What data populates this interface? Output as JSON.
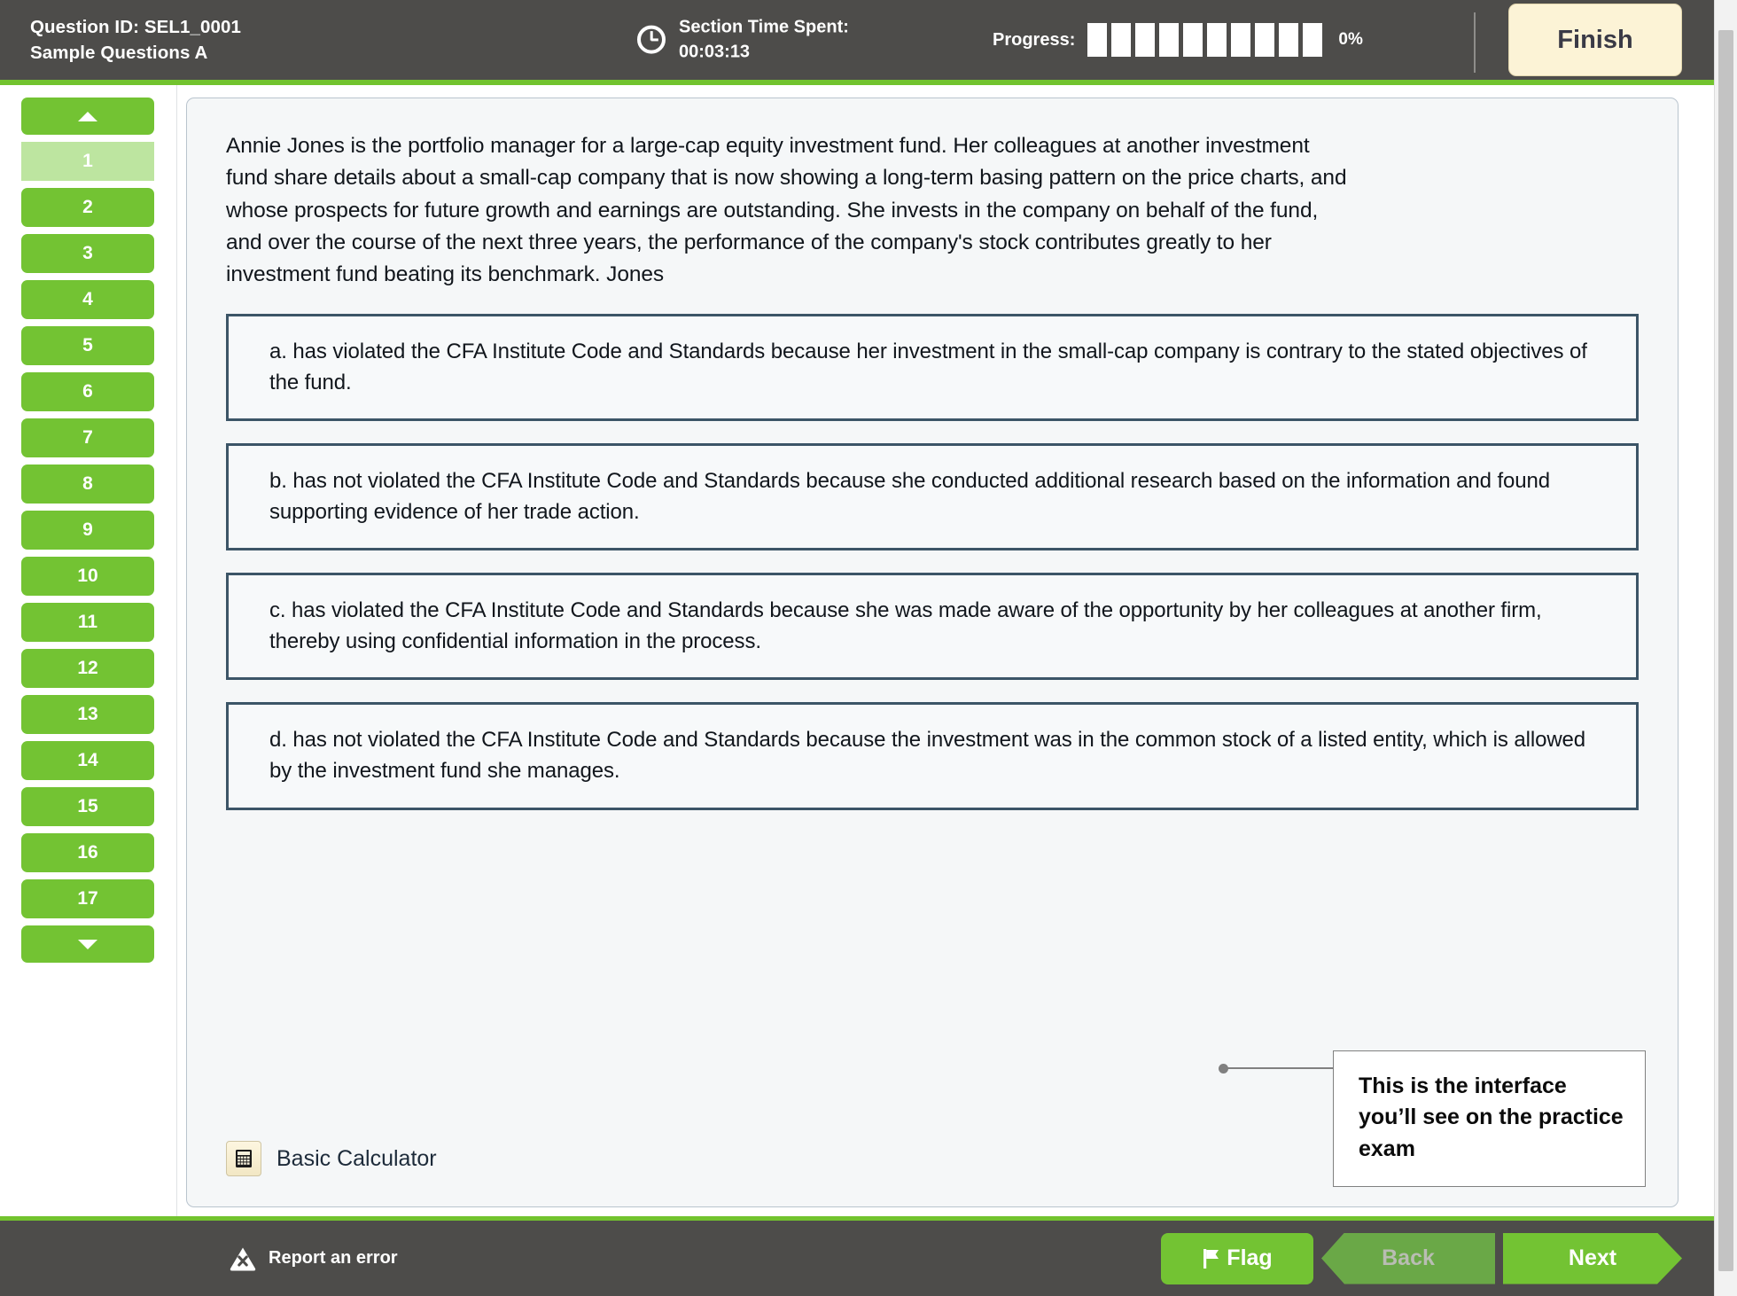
{
  "header": {
    "question_id_label": "Question ID: SEL1_0001",
    "section_name": "Sample Questions A",
    "clock_icon": "clock-icon",
    "time_spent_label": "Section Time Spent:",
    "time_spent_value": "00:03:13",
    "progress_label": "Progress:",
    "progress_percent": "0%",
    "progress_segments_total": 10,
    "progress_segments_filled": 0,
    "finish_label": "Finish",
    "accent_color": "#72c32e",
    "bar_color": "#4d4c4a",
    "finish_bg": "#fcf3d6"
  },
  "sidebar": {
    "scroll_up_icon": "triangle-up-icon",
    "scroll_down_icon": "triangle-down-icon",
    "active_index": 1,
    "active_color": "#bde5a0",
    "item_color": "#73c333",
    "items": [
      {
        "label": "1",
        "active": true
      },
      {
        "label": "2",
        "active": false
      },
      {
        "label": "3",
        "active": false
      },
      {
        "label": "4",
        "active": false
      },
      {
        "label": "5",
        "active": false
      },
      {
        "label": "6",
        "active": false
      },
      {
        "label": "7",
        "active": false
      },
      {
        "label": "8",
        "active": false
      },
      {
        "label": "9",
        "active": false
      },
      {
        "label": "10",
        "active": false
      },
      {
        "label": "11",
        "active": false
      },
      {
        "label": "12",
        "active": false
      },
      {
        "label": "13",
        "active": false
      },
      {
        "label": "14",
        "active": false
      },
      {
        "label": "15",
        "active": false
      },
      {
        "label": "16",
        "active": false
      },
      {
        "label": "17",
        "active": false
      }
    ]
  },
  "question": {
    "stem": "Annie Jones is the portfolio manager for a large-cap equity investment fund. Her colleagues at another investment fund share details about a small-cap company that is now showing a long-term basing pattern on the price charts, and whose prospects for future growth and earnings are outstanding. She invests in the company on behalf of the fund, and over the course of the next three years, the performance of the company's stock contributes greatly to her investment fund beating its benchmark. Jones",
    "options": [
      {
        "id": "a",
        "text": "a. has violated the CFA Institute Code and Standards because her investment in the small-cap company is contrary to the stated objectives of the fund."
      },
      {
        "id": "b",
        "text": "b. has not violated the CFA Institute Code and Standards because she conducted additional research based on the information and found supporting evidence of her trade action."
      },
      {
        "id": "c",
        "text": "c. has violated the CFA Institute Code and Standards because she was made aware of the opportunity by her colleagues at another firm, thereby using confidential information in the process."
      },
      {
        "id": "d",
        "text": "d. has not violated the CFA Institute Code and Standards because the investment was in the common stock of a listed entity, which is allowed by the investment fund she manages."
      }
    ],
    "option_border_color": "#3c5567"
  },
  "tools": {
    "calculator_icon": "calculator-icon",
    "calculator_label": "Basic Calculator"
  },
  "callout": {
    "text": "This is the interface you’ll see on the practice exam"
  },
  "footer": {
    "report_icon": "warning-triangle-icon",
    "report_label": "Report an error",
    "flag_icon": "flag-icon",
    "flag_label": "Flag",
    "back_label": "Back",
    "next_label": "Next",
    "back_disabled": true
  }
}
